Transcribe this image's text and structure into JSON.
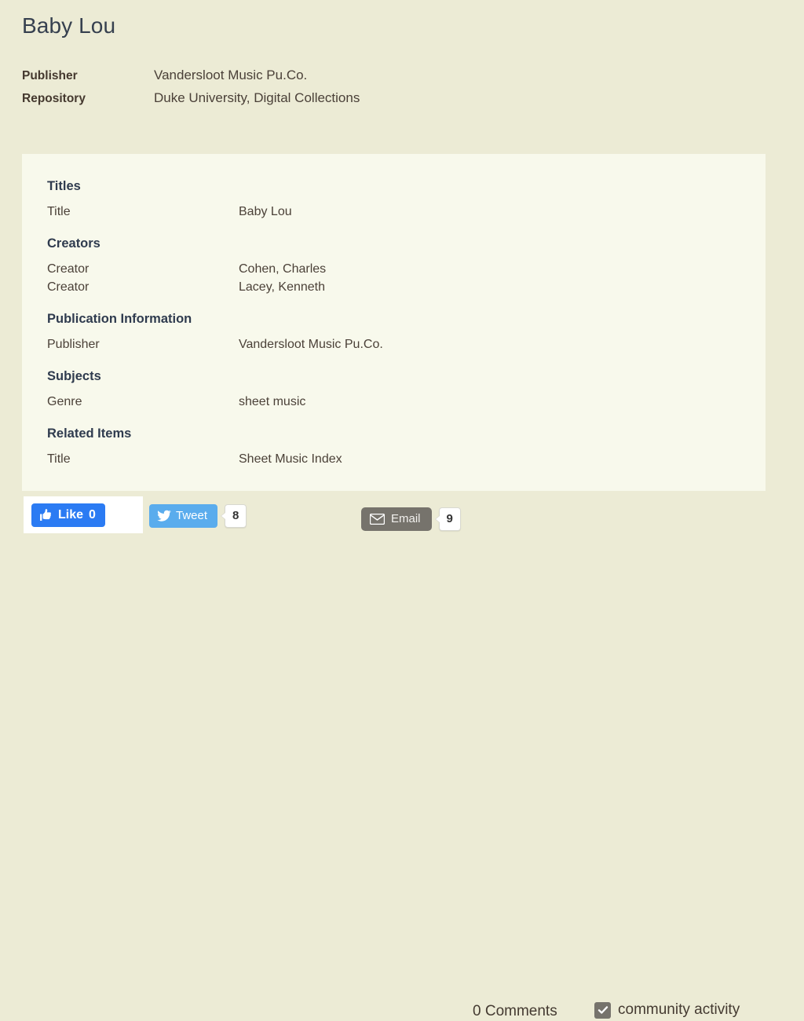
{
  "page": {
    "title": "Baby Lou",
    "background_color": "#ecebd5",
    "panel_color": "#f8f9ec"
  },
  "summary": {
    "rows": [
      {
        "label": "Publisher",
        "value": "Vandersloot Music Pu.Co."
      },
      {
        "label": "Repository",
        "value": "Duke University, Digital Collections"
      }
    ]
  },
  "metadata": {
    "sections": [
      {
        "heading": "Titles",
        "rows": [
          {
            "label": "Title",
            "value": "Baby Lou"
          }
        ]
      },
      {
        "heading": "Creators",
        "rows": [
          {
            "label": "Creator",
            "value": "Cohen, Charles"
          },
          {
            "label": "Creator",
            "value": "Lacey, Kenneth"
          }
        ]
      },
      {
        "heading": "Publication Information",
        "rows": [
          {
            "label": "Publisher",
            "value": "Vandersloot Music Pu.Co."
          }
        ]
      },
      {
        "heading": "Subjects",
        "rows": [
          {
            "label": "Genre",
            "value": "sheet music"
          }
        ]
      },
      {
        "heading": "Related Items",
        "rows": [
          {
            "label": "Title",
            "value": "Sheet Music Index"
          }
        ]
      }
    ]
  },
  "social_bar": {
    "facebook": {
      "icon": "thumbs-up-icon",
      "label": "Like",
      "count": "0",
      "color": "#2b7bf3"
    },
    "twitter": {
      "icon": "twitter-bird-icon",
      "label": "Tweet",
      "count": "8",
      "color": "#5aaced"
    },
    "email": {
      "icon": "envelope-icon",
      "label": "Email",
      "count": "9",
      "color": "#76736c"
    },
    "comments": {
      "label": "0 Comments"
    },
    "community_activity": {
      "label": "community activity",
      "checked": true,
      "color": "#76736c"
    }
  }
}
